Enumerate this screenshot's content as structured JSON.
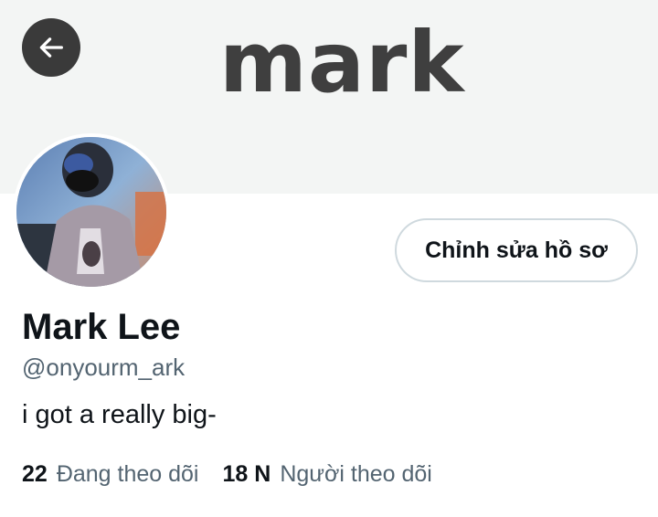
{
  "header": {
    "banner_text": "mark",
    "back_icon": "arrow-left-icon"
  },
  "profile": {
    "edit_button_label": "Chỉnh sửa hồ sơ",
    "display_name": "Mark Lee",
    "handle": "@onyourm_ark",
    "bio": "i got a really big-",
    "following_count": "22",
    "following_label": "Đang theo dõi",
    "followers_count": "18 N",
    "followers_label": "Người theo dõi"
  },
  "colors": {
    "banner_bg": "#f3f5f4",
    "back_button_bg": "#3a3a3a",
    "secondary_text": "#536471",
    "button_border": "#cfd9de"
  }
}
